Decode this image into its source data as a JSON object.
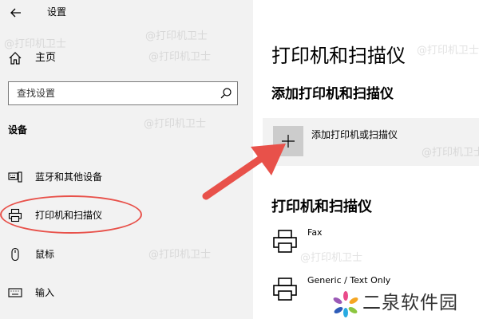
{
  "window": {
    "title": "设置"
  },
  "sidebar": {
    "home_label": "主页",
    "search_placeholder": "查找设置",
    "section_label": "设备",
    "items": [
      {
        "label": "蓝牙和其他设备",
        "icon": "bluetooth-devices-icon"
      },
      {
        "label": "打印机和扫描仪",
        "icon": "printer-icon"
      },
      {
        "label": "鼠标",
        "icon": "mouse-icon"
      },
      {
        "label": "输入",
        "icon": "keyboard-icon"
      }
    ]
  },
  "main": {
    "title": "打印机和扫描仪",
    "add_section_title": "添加打印机和扫描仪",
    "add_button_label": "添加打印机或扫描仪",
    "list_title": "打印机和扫描仪",
    "printers": [
      {
        "name": "Fax"
      },
      {
        "name": "Generic / Text Only"
      }
    ]
  },
  "watermark": {
    "text": "@打印机卫士"
  },
  "branding": {
    "logo_text": "二泉软件园"
  },
  "colors": {
    "annotation_red": "#e8514a",
    "sidebar_bg": "#f2f2f2"
  }
}
